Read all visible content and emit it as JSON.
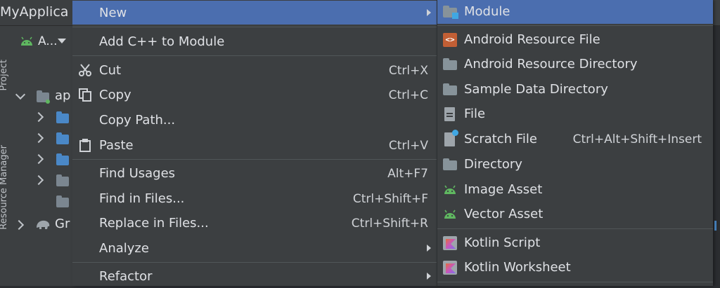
{
  "app": {
    "title": "MyApplica"
  },
  "side_tabs": {
    "project": "Project",
    "resource_manager": "Resource Manager"
  },
  "tree": {
    "view_selector": "A...",
    "items": [
      {
        "label": "ap"
      },
      {
        "label": "Gr"
      }
    ]
  },
  "menu": {
    "items": [
      {
        "label": "New",
        "shortcut": "",
        "submenu": true,
        "selected": true
      },
      {
        "label": "Add C++ to Module",
        "shortcut": ""
      },
      {
        "label": "Cut",
        "shortcut": "Ctrl+X",
        "icon": "scissors-icon"
      },
      {
        "label": "Copy",
        "shortcut": "Ctrl+C",
        "icon": "copy-icon"
      },
      {
        "label": "Copy Path...",
        "shortcut": ""
      },
      {
        "label": "Paste",
        "shortcut": "Ctrl+V",
        "icon": "clipboard-icon"
      },
      {
        "label": "Find Usages",
        "shortcut": "Alt+F7"
      },
      {
        "label": "Find in Files...",
        "shortcut": "Ctrl+Shift+F"
      },
      {
        "label": "Replace in Files...",
        "shortcut": "Ctrl+Shift+R"
      },
      {
        "label": "Analyze",
        "shortcut": "",
        "submenu": true
      },
      {
        "label": "Refactor",
        "shortcut": "",
        "submenu": true
      }
    ]
  },
  "submenu": {
    "items": [
      {
        "label": "Module",
        "icon": "module-icon",
        "selected": true
      },
      {
        "label": "Android Resource File",
        "icon": "android-resource-file-icon"
      },
      {
        "label": "Android Resource Directory",
        "icon": "folder-icon"
      },
      {
        "label": "Sample Data Directory",
        "icon": "folder-icon"
      },
      {
        "label": "File",
        "icon": "file-icon"
      },
      {
        "label": "Scratch File",
        "shortcut": "Ctrl+Alt+Shift+Insert",
        "icon": "scratch-file-icon"
      },
      {
        "label": "Directory",
        "icon": "folder-icon"
      },
      {
        "label": "Image Asset",
        "icon": "android-icon"
      },
      {
        "label": "Vector Asset",
        "icon": "android-icon"
      },
      {
        "label": "Kotlin Script",
        "icon": "kotlin-icon"
      },
      {
        "label": "Kotlin Worksheet",
        "icon": "kotlin-icon"
      }
    ]
  },
  "colors": {
    "selection": "#4b6eaf",
    "menu_bg": "#3c3f41",
    "android_green": "#5fb760"
  }
}
